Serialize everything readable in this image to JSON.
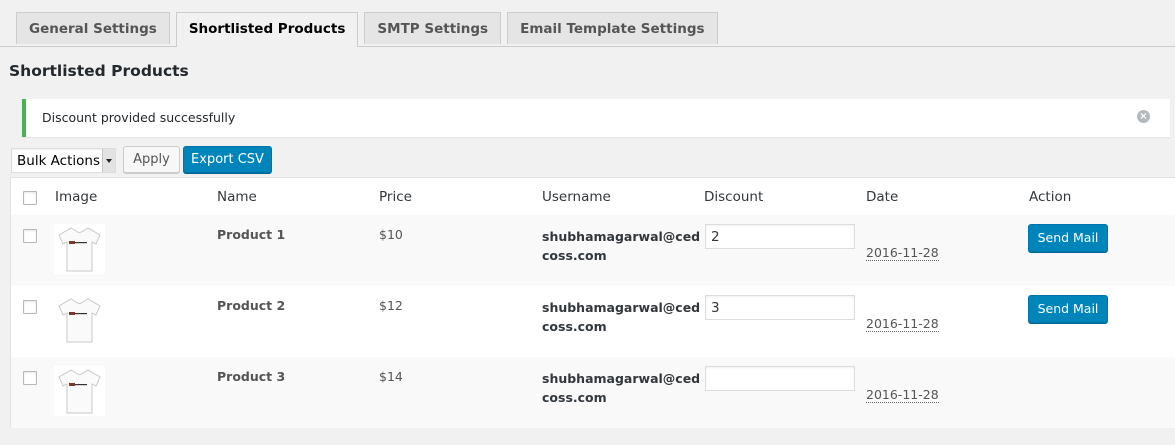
{
  "tabs": [
    {
      "label": "General Settings"
    },
    {
      "label": "Shortlisted Products"
    },
    {
      "label": "SMTP Settings"
    },
    {
      "label": "Email Template Settings"
    }
  ],
  "active_tab": 1,
  "page_title": "Shortlisted Products",
  "notice": {
    "message": "Discount provided successfully",
    "color": "#46b450"
  },
  "toolbar": {
    "bulk_actions": "Bulk Actions",
    "apply": "Apply",
    "export": "Export CSV"
  },
  "table": {
    "columns": [
      "Image",
      "Name",
      "Price",
      "Username",
      "Discount",
      "Date",
      "Action"
    ],
    "rows": [
      {
        "name": "Product 1",
        "price": "$10",
        "user_line1": "shubhamagarwal@ced",
        "user_line2": "coss.com",
        "discount": "2",
        "date": "2016-11-28",
        "action": "Send Mail"
      },
      {
        "name": "Product 2",
        "price": "$12",
        "user_line1": "shubhamagarwal@ced",
        "user_line2": "coss.com",
        "discount": "3",
        "date": "2016-11-28",
        "action": "Send Mail"
      },
      {
        "name": "Product 3",
        "price": "$14",
        "user_line1": "shubhamagarwal@ced",
        "user_line2": "coss.com",
        "discount": "",
        "date": "2016-11-28",
        "action": ""
      }
    ]
  },
  "colors": {
    "primary": "#0085ba",
    "background": "#f1f1f1",
    "success": "#46b450"
  }
}
